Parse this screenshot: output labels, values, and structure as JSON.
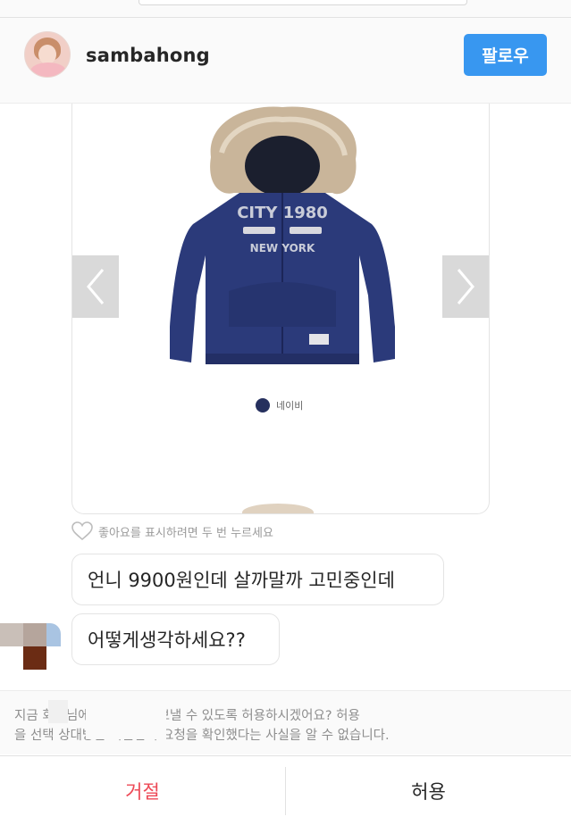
{
  "header": {
    "username": "sambahong",
    "follow_label": "팔로우"
  },
  "post": {
    "color_option": "네이비",
    "color_hex": "#26305e",
    "like_hint": "좋아요를 표시하려면 두 번 누르세요"
  },
  "messages": [
    "언니 9900원인데 살까말까 고민중인데",
    "어떻게생각하세요??"
  ],
  "request": {
    "line1": "지금          회원님에게 메시지를 보낼 수 있도록 허용하시겠어요? 허용",
    "line2": "을 선택        상대방은 회원님이 요청을 확인했다는 사실을 알 수 없습니다."
  },
  "actions": {
    "decline_label": "거절",
    "allow_label": "허용",
    "decline_color": "#ed4956",
    "accent": "#3897f0"
  }
}
